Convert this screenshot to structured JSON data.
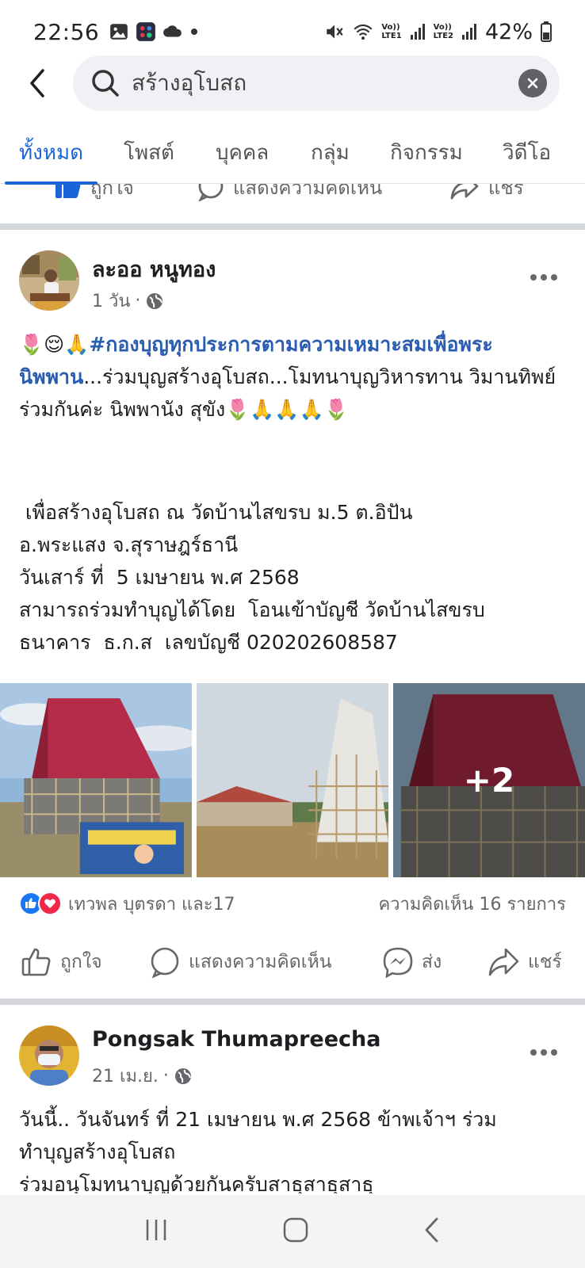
{
  "status_bar": {
    "time": "22:56",
    "battery": "42%",
    "net1": [
      "Vo))",
      "LTE1"
    ],
    "net2": [
      "Vo))",
      "LTE2"
    ]
  },
  "search": {
    "query": "สร้างอุโบสถ"
  },
  "tabs": [
    {
      "label": "ทั้งหมด",
      "active": true
    },
    {
      "label": "โพสต์"
    },
    {
      "label": "บุคคล"
    },
    {
      "label": "กลุ่ม"
    },
    {
      "label": "กิจกรรม"
    },
    {
      "label": "วิดีโอ"
    }
  ],
  "prev_actions": {
    "like": "ถูกใจ",
    "comment": "แสดงความคิดเห็น",
    "share": "แชร์"
  },
  "post1": {
    "author": "ละออ หนูทอง",
    "time": "1 วัน",
    "emoji_start": "🌷😌🙏",
    "hashtag": "#กองบุญทุกประการตามความเหมาะสมเพื่อพระนิพพาน",
    "text_after_hashtag": "...ร่วมบุญสร้างอุโบสถ...โมทนาบุญวิหารทาน วิมานทิพย์ ร่วมกันค่ะ นิพพานัง สุขัง🌷🙏🙏🙏🌷",
    "body": " เพื่อสร้างอุโบสถ ณ วัดบ้านไสขรบ ม.5 ต.อิปัน\nอ.พระแสง จ.สุราษฎร์ธานี\nวันเสาร์ ที่  5 เมษายน พ.ศ 2568\nสามารถร่วมทำบุญได้โดย  โอนเข้าบัญชี วัดบ้านไสขรบ\nธนาคาร  ธ.ก.ส  เลขบัญชี 020202608587",
    "more_photos": "+2",
    "reactions_text": "เทวพล บุตรดา และ17",
    "comments_text": "ความคิดเห็น 16 รายการ",
    "actions": {
      "like": "ถูกใจ",
      "comment": "แสดงความคิดเห็น",
      "send": "ส่ง",
      "share": "แชร์"
    }
  },
  "post2": {
    "author": "Pongsak Thumapreecha",
    "time": "21 เม.ย.",
    "body": "วันนี้.. วันจันทร์ ที่ 21 เมษายน พ.ศ 2568 ข้าพเจ้าฯ ร่วม\nทำบุญสร้างอุโบสถ\nร่วมอนุโมทนาบุญด้วยกันครับสาธุสาธุสาธุ"
  },
  "colors": {
    "accent": "#1b64d8",
    "hashtag": "#2a5db0",
    "like": "#1877f2",
    "love": "#f0284a"
  }
}
